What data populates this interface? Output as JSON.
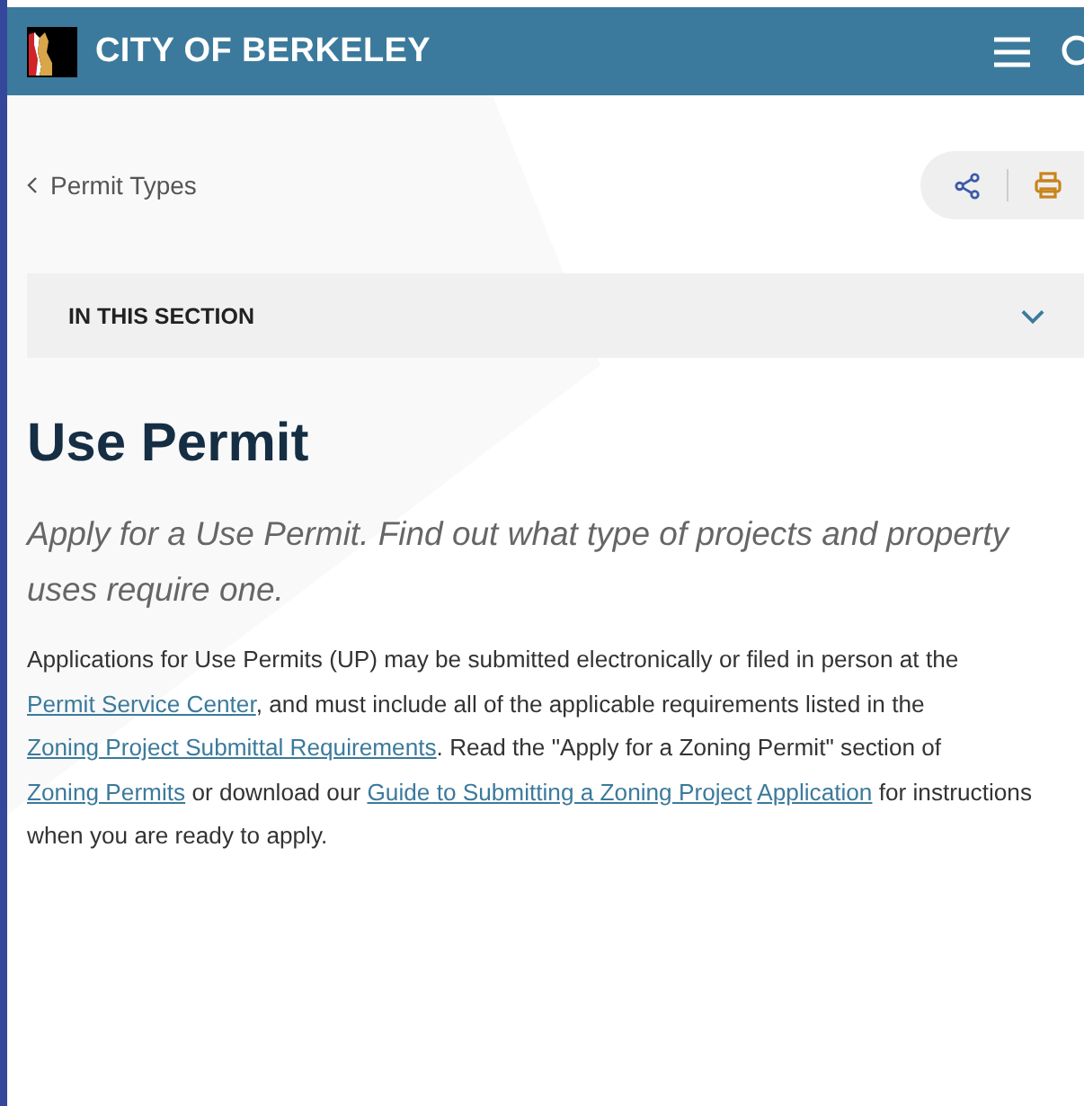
{
  "header": {
    "title": "CITY OF BERKELEY"
  },
  "breadcrumb": {
    "label": "Permit Types"
  },
  "section_menu": {
    "label": "IN THIS SECTION",
    "expanded": false
  },
  "page": {
    "title": "Use Permit",
    "subtitle": "Apply for a Use Permit. Find out what type of projects and property uses require one."
  },
  "body": [
    {
      "kind": "text",
      "text": "Applications for Use Permits (UP) may be submitted electronically or filed in person at the "
    },
    {
      "kind": "link",
      "text": "Permit Service Center"
    },
    {
      "kind": "text",
      "text": ", and must include all of the applicable requirements listed in the "
    },
    {
      "kind": "link",
      "text": "Zoning Project Submittal Requirements"
    },
    {
      "kind": "text",
      "text": ". Read the \"Apply for a Zoning Permit\" section of "
    },
    {
      "kind": "link",
      "text": "Zoning Permits"
    },
    {
      "kind": "text",
      "text": " or download our "
    },
    {
      "kind": "link",
      "text": "Guide to Submitting a Zoning Project"
    },
    {
      "kind": "link",
      "text": "Application"
    },
    {
      "kind": "text",
      "text": " for instructions when you are ready to apply."
    }
  ]
}
